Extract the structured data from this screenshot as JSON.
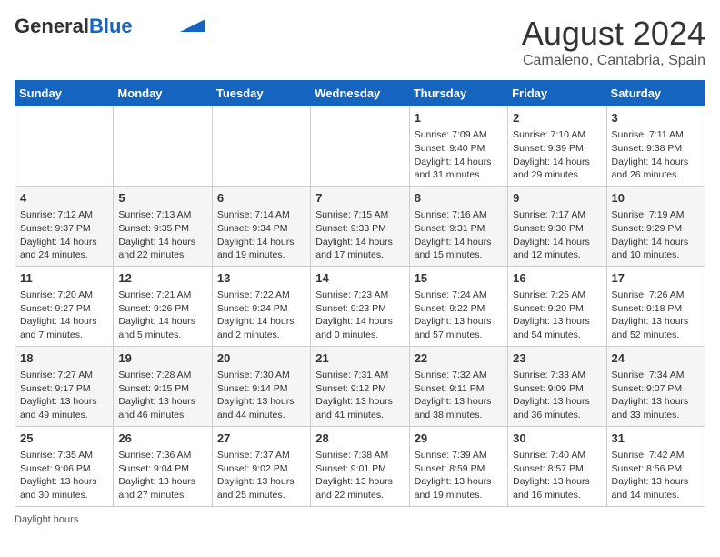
{
  "header": {
    "logo_general": "General",
    "logo_blue": "Blue",
    "month_year": "August 2024",
    "location": "Camaleno, Cantabria, Spain"
  },
  "weekdays": [
    "Sunday",
    "Monday",
    "Tuesday",
    "Wednesday",
    "Thursday",
    "Friday",
    "Saturday"
  ],
  "weeks": [
    [
      {
        "day": "",
        "sunrise": "",
        "sunset": "",
        "daylight": ""
      },
      {
        "day": "",
        "sunrise": "",
        "sunset": "",
        "daylight": ""
      },
      {
        "day": "",
        "sunrise": "",
        "sunset": "",
        "daylight": ""
      },
      {
        "day": "",
        "sunrise": "",
        "sunset": "",
        "daylight": ""
      },
      {
        "day": "1",
        "sunrise": "Sunrise: 7:09 AM",
        "sunset": "Sunset: 9:40 PM",
        "daylight": "Daylight: 14 hours and 31 minutes."
      },
      {
        "day": "2",
        "sunrise": "Sunrise: 7:10 AM",
        "sunset": "Sunset: 9:39 PM",
        "daylight": "Daylight: 14 hours and 29 minutes."
      },
      {
        "day": "3",
        "sunrise": "Sunrise: 7:11 AM",
        "sunset": "Sunset: 9:38 PM",
        "daylight": "Daylight: 14 hours and 26 minutes."
      }
    ],
    [
      {
        "day": "4",
        "sunrise": "Sunrise: 7:12 AM",
        "sunset": "Sunset: 9:37 PM",
        "daylight": "Daylight: 14 hours and 24 minutes."
      },
      {
        "day": "5",
        "sunrise": "Sunrise: 7:13 AM",
        "sunset": "Sunset: 9:35 PM",
        "daylight": "Daylight: 14 hours and 22 minutes."
      },
      {
        "day": "6",
        "sunrise": "Sunrise: 7:14 AM",
        "sunset": "Sunset: 9:34 PM",
        "daylight": "Daylight: 14 hours and 19 minutes."
      },
      {
        "day": "7",
        "sunrise": "Sunrise: 7:15 AM",
        "sunset": "Sunset: 9:33 PM",
        "daylight": "Daylight: 14 hours and 17 minutes."
      },
      {
        "day": "8",
        "sunrise": "Sunrise: 7:16 AM",
        "sunset": "Sunset: 9:31 PM",
        "daylight": "Daylight: 14 hours and 15 minutes."
      },
      {
        "day": "9",
        "sunrise": "Sunrise: 7:17 AM",
        "sunset": "Sunset: 9:30 PM",
        "daylight": "Daylight: 14 hours and 12 minutes."
      },
      {
        "day": "10",
        "sunrise": "Sunrise: 7:19 AM",
        "sunset": "Sunset: 9:29 PM",
        "daylight": "Daylight: 14 hours and 10 minutes."
      }
    ],
    [
      {
        "day": "11",
        "sunrise": "Sunrise: 7:20 AM",
        "sunset": "Sunset: 9:27 PM",
        "daylight": "Daylight: 14 hours and 7 minutes."
      },
      {
        "day": "12",
        "sunrise": "Sunrise: 7:21 AM",
        "sunset": "Sunset: 9:26 PM",
        "daylight": "Daylight: 14 hours and 5 minutes."
      },
      {
        "day": "13",
        "sunrise": "Sunrise: 7:22 AM",
        "sunset": "Sunset: 9:24 PM",
        "daylight": "Daylight: 14 hours and 2 minutes."
      },
      {
        "day": "14",
        "sunrise": "Sunrise: 7:23 AM",
        "sunset": "Sunset: 9:23 PM",
        "daylight": "Daylight: 14 hours and 0 minutes."
      },
      {
        "day": "15",
        "sunrise": "Sunrise: 7:24 AM",
        "sunset": "Sunset: 9:22 PM",
        "daylight": "Daylight: 13 hours and 57 minutes."
      },
      {
        "day": "16",
        "sunrise": "Sunrise: 7:25 AM",
        "sunset": "Sunset: 9:20 PM",
        "daylight": "Daylight: 13 hours and 54 minutes."
      },
      {
        "day": "17",
        "sunrise": "Sunrise: 7:26 AM",
        "sunset": "Sunset: 9:18 PM",
        "daylight": "Daylight: 13 hours and 52 minutes."
      }
    ],
    [
      {
        "day": "18",
        "sunrise": "Sunrise: 7:27 AM",
        "sunset": "Sunset: 9:17 PM",
        "daylight": "Daylight: 13 hours and 49 minutes."
      },
      {
        "day": "19",
        "sunrise": "Sunrise: 7:28 AM",
        "sunset": "Sunset: 9:15 PM",
        "daylight": "Daylight: 13 hours and 46 minutes."
      },
      {
        "day": "20",
        "sunrise": "Sunrise: 7:30 AM",
        "sunset": "Sunset: 9:14 PM",
        "daylight": "Daylight: 13 hours and 44 minutes."
      },
      {
        "day": "21",
        "sunrise": "Sunrise: 7:31 AM",
        "sunset": "Sunset: 9:12 PM",
        "daylight": "Daylight: 13 hours and 41 minutes."
      },
      {
        "day": "22",
        "sunrise": "Sunrise: 7:32 AM",
        "sunset": "Sunset: 9:11 PM",
        "daylight": "Daylight: 13 hours and 38 minutes."
      },
      {
        "day": "23",
        "sunrise": "Sunrise: 7:33 AM",
        "sunset": "Sunset: 9:09 PM",
        "daylight": "Daylight: 13 hours and 36 minutes."
      },
      {
        "day": "24",
        "sunrise": "Sunrise: 7:34 AM",
        "sunset": "Sunset: 9:07 PM",
        "daylight": "Daylight: 13 hours and 33 minutes."
      }
    ],
    [
      {
        "day": "25",
        "sunrise": "Sunrise: 7:35 AM",
        "sunset": "Sunset: 9:06 PM",
        "daylight": "Daylight: 13 hours and 30 minutes."
      },
      {
        "day": "26",
        "sunrise": "Sunrise: 7:36 AM",
        "sunset": "Sunset: 9:04 PM",
        "daylight": "Daylight: 13 hours and 27 minutes."
      },
      {
        "day": "27",
        "sunrise": "Sunrise: 7:37 AM",
        "sunset": "Sunset: 9:02 PM",
        "daylight": "Daylight: 13 hours and 25 minutes."
      },
      {
        "day": "28",
        "sunrise": "Sunrise: 7:38 AM",
        "sunset": "Sunset: 9:01 PM",
        "daylight": "Daylight: 13 hours and 22 minutes."
      },
      {
        "day": "29",
        "sunrise": "Sunrise: 7:39 AM",
        "sunset": "Sunset: 8:59 PM",
        "daylight": "Daylight: 13 hours and 19 minutes."
      },
      {
        "day": "30",
        "sunrise": "Sunrise: 7:40 AM",
        "sunset": "Sunset: 8:57 PM",
        "daylight": "Daylight: 13 hours and 16 minutes."
      },
      {
        "day": "31",
        "sunrise": "Sunrise: 7:42 AM",
        "sunset": "Sunset: 8:56 PM",
        "daylight": "Daylight: 13 hours and 14 minutes."
      }
    ]
  ],
  "footer": {
    "daylight_hours": "Daylight hours"
  }
}
